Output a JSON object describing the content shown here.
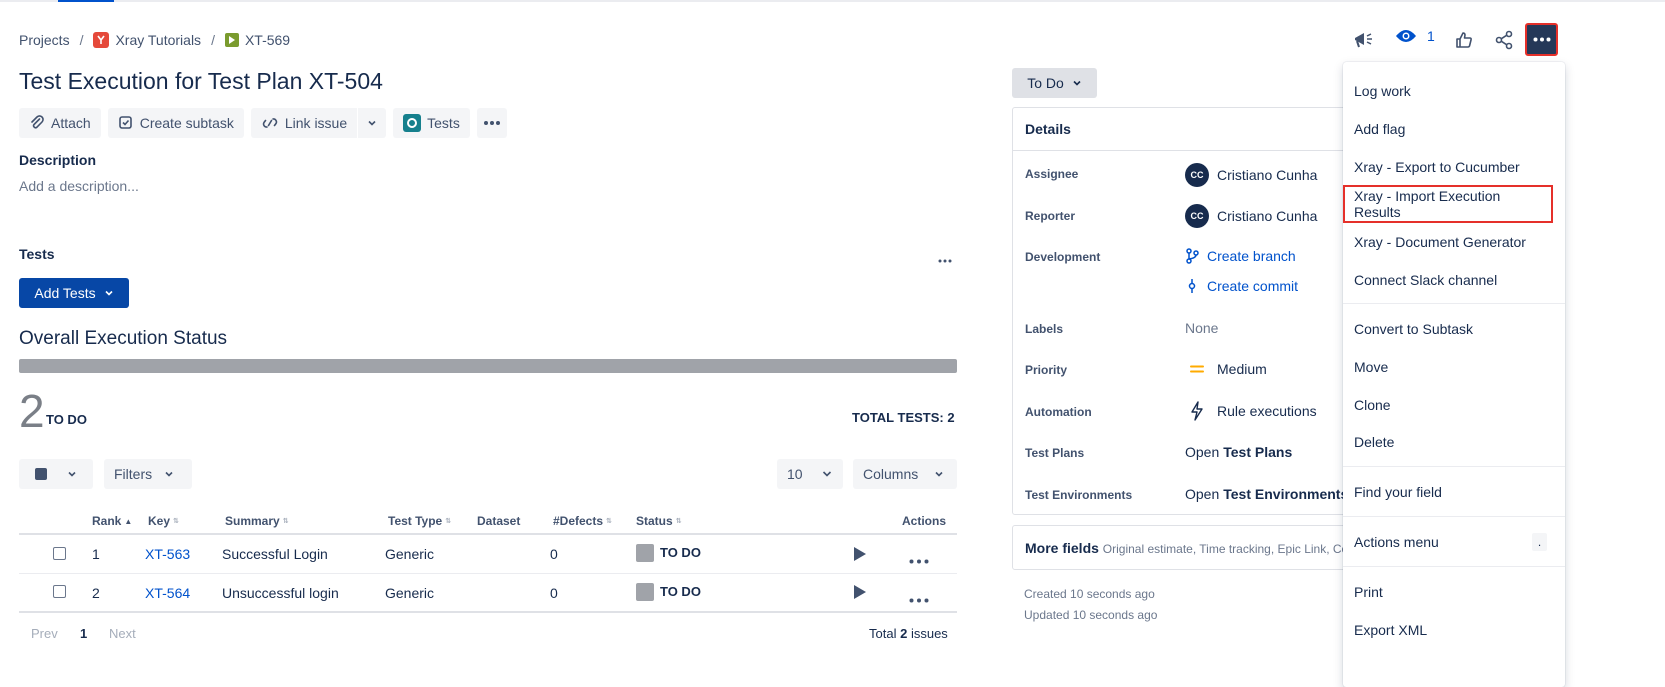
{
  "breadcrumb": {
    "projects": "Projects",
    "project_name": "Xray Tutorials",
    "issue_key": "XT-569"
  },
  "issue": {
    "title": "Test Execution for Test Plan XT-504"
  },
  "toolbar": {
    "attach": "Attach",
    "create_subtask": "Create subtask",
    "link_issue": "Link issue",
    "tests": "Tests"
  },
  "description": {
    "label": "Description",
    "placeholder": "Add a description..."
  },
  "tests_section": {
    "label": "Tests",
    "add_tests": "Add Tests",
    "overall_title": "Overall Execution Status",
    "todo_progress": 1.0,
    "todo_count": "2",
    "todo_label": "TO DO",
    "total_tests": "TOTAL TESTS: 2",
    "filters": "Filters",
    "page_size": "10",
    "columns": "Columns"
  },
  "table": {
    "headers": {
      "rank": "Rank",
      "key": "Key",
      "summary": "Summary",
      "test_type": "Test Type",
      "dataset": "Dataset",
      "defects": "#Defects",
      "status": "Status",
      "actions": "Actions"
    },
    "rows": [
      {
        "rank": "1",
        "key": "XT-563",
        "summary": "Successful Login",
        "type": "Generic",
        "defects": "0",
        "status": "TO DO"
      },
      {
        "rank": "2",
        "key": "XT-564",
        "summary": "Unsuccessful login",
        "type": "Generic",
        "defects": "0",
        "status": "TO DO"
      }
    ],
    "pager": {
      "prev": "Prev",
      "page": "1",
      "next": "Next"
    },
    "total_prefix": "Total",
    "total_count": "2",
    "total_suffix": "issues"
  },
  "status_button": "To Do",
  "details": {
    "title": "Details",
    "assignee_label": "Assignee",
    "assignee": "Cristiano Cunha",
    "assignee_initials": "CC",
    "reporter_label": "Reporter",
    "reporter": "Cristiano Cunha",
    "reporter_initials": "CC",
    "development_label": "Development",
    "create_branch": "Create branch",
    "create_commit": "Create commit",
    "labels_label": "Labels",
    "labels_value": "None",
    "priority_label": "Priority",
    "priority_value": "Medium",
    "automation_label": "Automation",
    "automation_value": "Rule executions",
    "test_plans_label": "Test Plans",
    "test_plans_open": "Open",
    "test_plans_value": "Test Plans",
    "test_env_label": "Test Environments",
    "test_env_open": "Open",
    "test_env_value": "Test Environments"
  },
  "more_fields": {
    "label": "More fields",
    "hint": "Original estimate, Time tracking, Epic Link, Co"
  },
  "meta": {
    "created": "Created 10 seconds ago",
    "updated": "Updated 10 seconds ago"
  },
  "header_actions": {
    "watch_count": "1"
  },
  "menu": {
    "items": [
      "Log work",
      "Add flag",
      "Xray - Export to Cucumber",
      "Xray - Import Execution Results",
      "Xray - Document Generator",
      "Connect Slack channel",
      "Convert to Subtask",
      "Move",
      "Clone",
      "Delete",
      "Find your field",
      "Actions menu",
      "Print",
      "Export XML"
    ],
    "actions_shortcut": "."
  },
  "colors": {
    "primary": "#0747a6",
    "link": "#0052cc",
    "highlight": "#e5302a",
    "todo": "#a0a3a9"
  }
}
